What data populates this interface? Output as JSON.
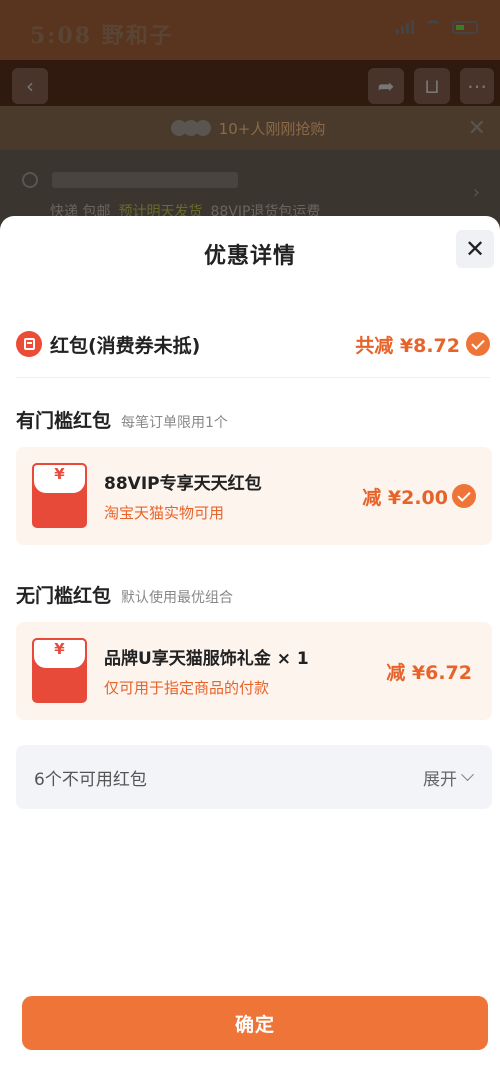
{
  "status_bar": {
    "brand": "5:08 野和子"
  },
  "nav": {
    "cart_badge": ""
  },
  "background": {
    "promo": "10+人刚刚抢购",
    "shipping": [
      "快递 包邮",
      "预计明天发货",
      "88VIP退货包运费"
    ]
  },
  "sheet": {
    "title": "优惠详情",
    "total": {
      "label": "红包(消费券未抵)",
      "value": "共减 ¥8.72"
    },
    "threshold_section": {
      "title": "有门槛红包",
      "subtitle": "每笔订单限用1个",
      "card": {
        "yen": "¥",
        "title": "88VIP专享天天红包",
        "desc": "淘宝天猫实物可用",
        "amount": "减 ¥2.00",
        "checked": true
      }
    },
    "no_threshold_section": {
      "title": "无门槛红包",
      "subtitle": "默认使用最优组合",
      "card": {
        "yen": "¥",
        "title": "品牌U享天猫服饰礼金 × 1",
        "desc": "仅可用于指定商品的付款",
        "amount": "减 ¥6.72",
        "checked": false
      }
    },
    "unavailable": {
      "label": "6个不可用红包",
      "expand": "展开"
    },
    "confirm_label": "确定"
  },
  "colors": {
    "accent": "#ee7437",
    "price": "#e8632a",
    "packet": "#e84a3a",
    "card_bg": "#fdf4ee"
  }
}
